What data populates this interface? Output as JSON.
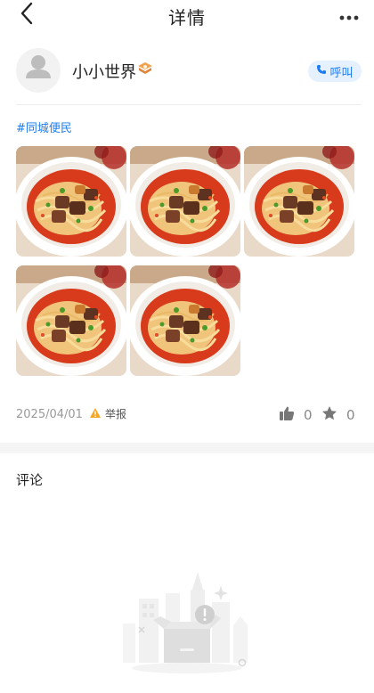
{
  "header": {
    "title": "详情"
  },
  "user": {
    "name": "小小世界",
    "call_label": "呼叫"
  },
  "post": {
    "tag": "#同城便民",
    "photos": [
      {
        "icon": "beef-noodle-photo"
      },
      {
        "icon": "beef-noodle-photo"
      },
      {
        "icon": "beef-noodle-photo"
      },
      {
        "icon": "beef-noodle-photo"
      },
      {
        "icon": "beef-noodle-photo"
      }
    ],
    "date": "2025/04/01",
    "report_label": "举报",
    "like_count": "0",
    "fav_count": "0"
  },
  "comments": {
    "title": "评论"
  },
  "colors": {
    "accent": "#1e7cf2",
    "call_bg": "#e6f1ff",
    "warning": "#f5a623",
    "section_gap": "#f5f5f5"
  }
}
